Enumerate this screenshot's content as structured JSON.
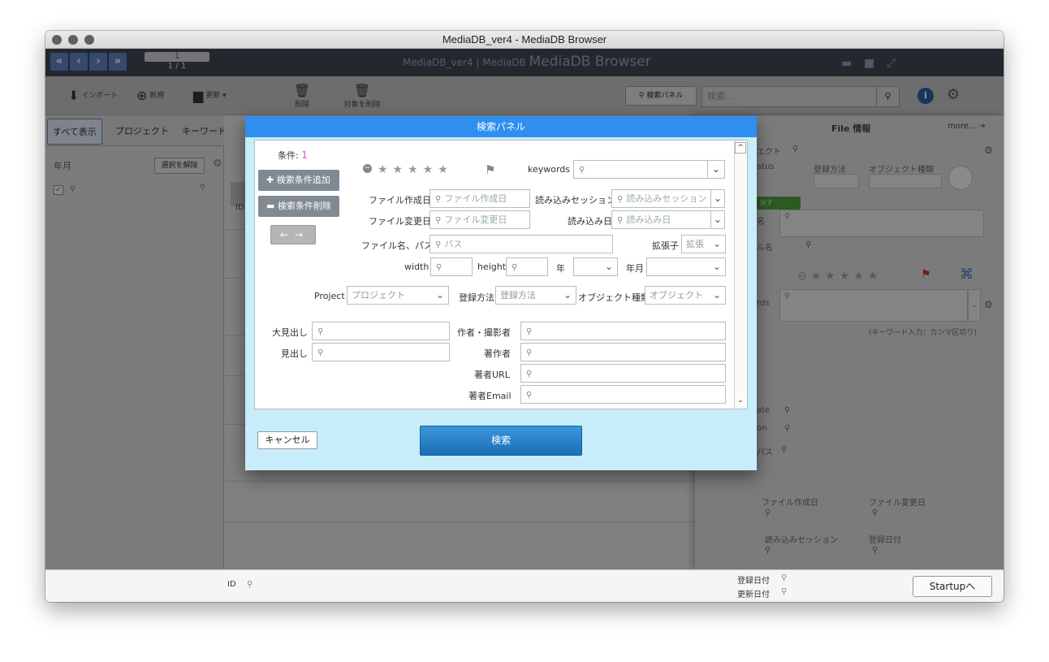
{
  "window": {
    "title": "MediaDB_ver4 - MediaDB Browser"
  },
  "app": {
    "header_title_small": "MediaDB_ver4 | MediaDB",
    "header_title_big": "MediaDB Browser",
    "page_current": "1",
    "page_total": "1 / 1",
    "toolbar": {
      "import": "インポート",
      "new": "新規",
      "update": "更新 ▾",
      "delete": "削除",
      "delete_target": "対象を削除",
      "search_panel": "検索パネル",
      "search_placeholder": "検索..."
    },
    "tabs": {
      "show_all": "すべて表示",
      "project": "プロジェクト",
      "keyword": "キーワード"
    },
    "left": {
      "year_month": "年月",
      "deselect": "選択を解除"
    },
    "grid": {
      "id_col": "ID"
    },
    "right_panel": {
      "title": "File 情報",
      "more": "more...",
      "f1": "エクト",
      "f2": "atus",
      "f3": "登録方法",
      "f4": "オブジェクト種類",
      "chip": "戻す",
      "f5": "名",
      "f6": "ル名",
      "f7": "rds",
      "hint": "(キーワード入力：カンマ区切り)",
      "f8": "ate",
      "f9": "on",
      "f10": "パス",
      "file_created": "ファイル作成日",
      "file_modified": "ファイル変更日",
      "import_session": "読み込みセッション",
      "registered_date": "登録日付"
    },
    "bottom": {
      "id": "ID",
      "registered_date": "登録日付",
      "updated_date": "更新日付",
      "startup": "Startupへ"
    }
  },
  "dialog": {
    "title": "検索パネル",
    "condition_label": "条件:",
    "condition_count": "1",
    "add_condition": "検索条件追加",
    "remove_condition": "検索条件削除",
    "keywords_label": "keywords",
    "file_created_label": "ファイル作成日",
    "file_created_placeholder": "ファイル作成日",
    "import_session_label": "読み込みセッション",
    "import_session_placeholder": "読み込みセッション",
    "file_modified_label": "ファイル変更日",
    "file_modified_placeholder": "ファイル変更日",
    "import_date_label": "読み込み日",
    "import_date_placeholder": "読み込み日",
    "filename_path_label": "ファイル名、パス",
    "path_placeholder": "パス",
    "extension_label": "拡張子",
    "extension_placeholder": "拡張",
    "width_label": "width",
    "height_label": "height",
    "year_label": "年",
    "year_month_label": "年月",
    "project_label": "Project",
    "project_placeholder": "プロジェクト",
    "reg_method_label": "登録方法",
    "reg_method_placeholder": "登録方法",
    "object_type_label": "オブジェクト種類",
    "object_type_placeholder": "オブジェクト",
    "headline_large_label": "大見出し",
    "headline_label": "見出し",
    "author_photographer_label": "作者・撮影者",
    "copyright_label": "著作者",
    "copyright_url_label": "著者URL",
    "copyright_email_label": "著者Email",
    "cancel": "キャンセル",
    "search": "検索"
  },
  "icons": {
    "search": "⚲",
    "chevron": "⌄",
    "star": "★",
    "flag": "⚑",
    "gear": "⚙",
    "info": "i"
  },
  "colors": {
    "dialog_title_bg": "#2f8ef0",
    "dialog_bg": "#c7edfb",
    "search_button": "#1c6db5",
    "condition_count": "#d94fd3",
    "nav_button": "#5b7fb8"
  }
}
